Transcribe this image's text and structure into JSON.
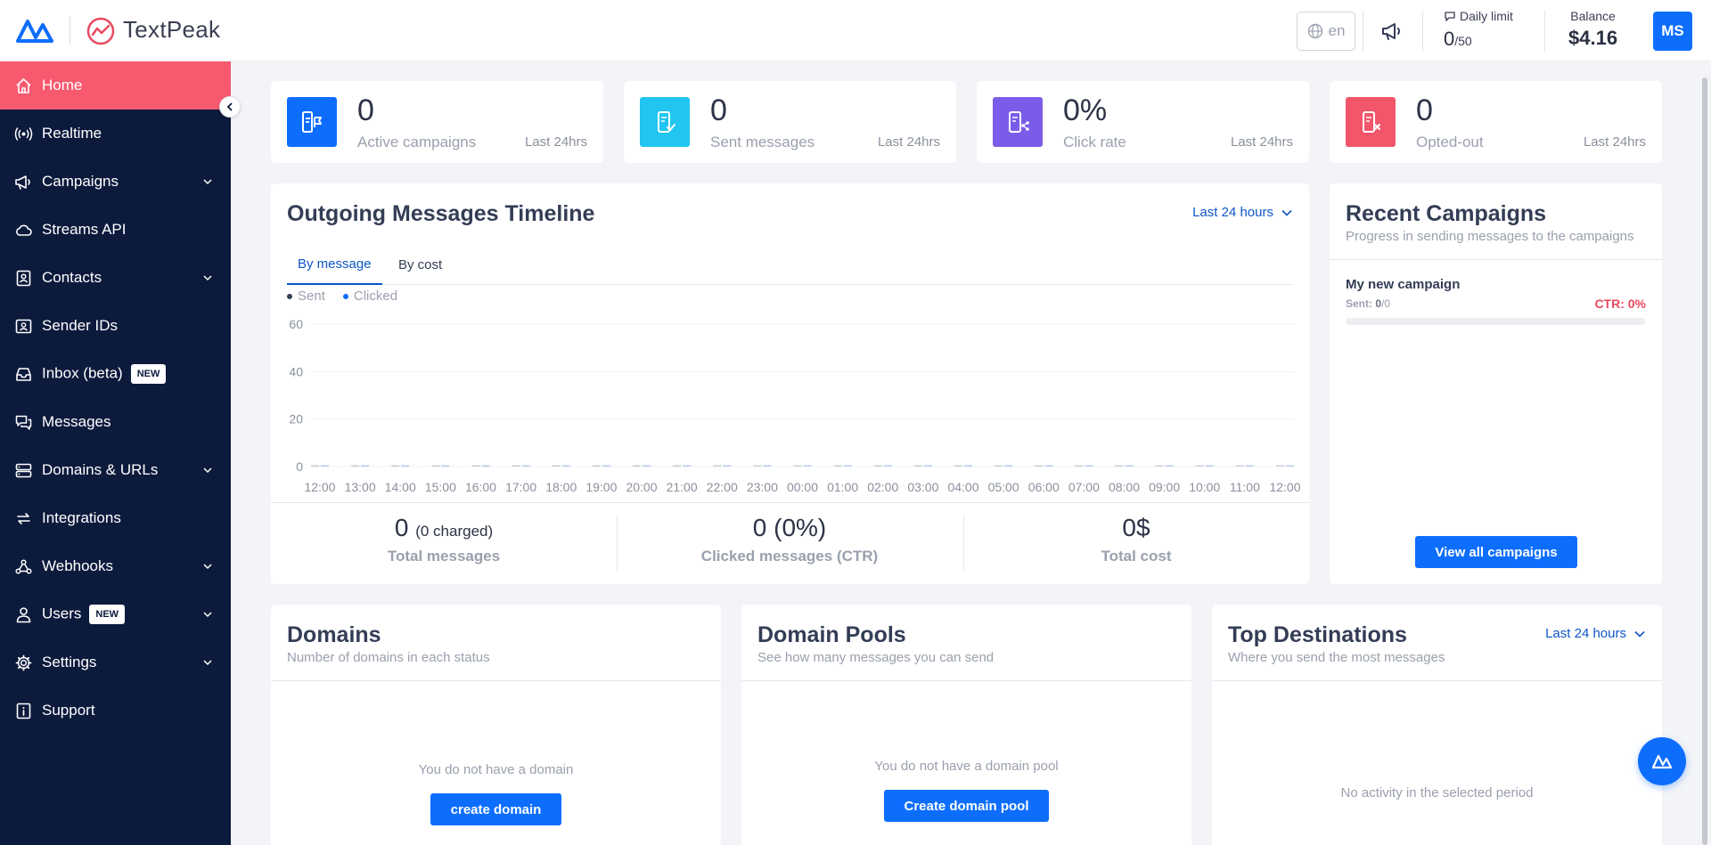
{
  "header": {
    "brand_name": "TextPeak",
    "language": "en",
    "daily_limit_label": "Daily limit",
    "daily_limit_used": "0",
    "daily_limit_max": "/50",
    "balance_label": "Balance",
    "balance_value": "$4.16",
    "avatar_initials": "MS"
  },
  "sidebar": {
    "items": [
      {
        "label": "Home",
        "icon": "home-icon",
        "active": true
      },
      {
        "label": "Realtime",
        "icon": "broadcast-icon"
      },
      {
        "label": "Campaigns",
        "icon": "megaphone-icon",
        "expandable": true
      },
      {
        "label": "Streams API",
        "icon": "cloud-icon"
      },
      {
        "label": "Contacts",
        "icon": "contact-book-icon",
        "expandable": true
      },
      {
        "label": "Sender IDs",
        "icon": "id-card-icon"
      },
      {
        "label": "Inbox (beta)",
        "icon": "inbox-icon",
        "badge": "NEW"
      },
      {
        "label": "Messages",
        "icon": "chat-icon"
      },
      {
        "label": "Domains & URLs",
        "icon": "server-icon",
        "expandable": true
      },
      {
        "label": "Integrations",
        "icon": "sync-icon"
      },
      {
        "label": "Webhooks",
        "icon": "webhook-icon",
        "expandable": true
      },
      {
        "label": "Users",
        "icon": "user-icon",
        "badge": "NEW",
        "expandable": true
      },
      {
        "label": "Settings",
        "icon": "gear-icon",
        "expandable": true
      },
      {
        "label": "Support",
        "icon": "info-icon"
      }
    ]
  },
  "stats": [
    {
      "value": "0",
      "label": "Active campaigns",
      "period": "Last 24hrs",
      "color": "#0d6efd"
    },
    {
      "value": "0",
      "label": "Sent messages",
      "period": "Last 24hrs",
      "color": "#22c5f0"
    },
    {
      "value": "0%",
      "label": "Click rate",
      "period": "Last 24hrs",
      "color": "#7b5ce8"
    },
    {
      "value": "0",
      "label": "Opted-out",
      "period": "Last 24hrs",
      "color": "#f2566b"
    }
  ],
  "timeline": {
    "title": "Outgoing Messages Timeline",
    "period": "Last 24 hours",
    "tabs": [
      "By message",
      "By cost"
    ],
    "legend": [
      {
        "label": "Sent",
        "color": "#333d55"
      },
      {
        "label": "Clicked",
        "color": "#0d6efd"
      }
    ],
    "totals": {
      "messages_value": "0",
      "messages_charged": "(0 charged)",
      "messages_label": "Total messages",
      "clicked_value": "0 (0%)",
      "clicked_label": "Clicked messages (CTR)",
      "cost_value": "0$",
      "cost_label": "Total cost"
    }
  },
  "chart_data": {
    "type": "bar",
    "categories": [
      "12:00",
      "13:00",
      "14:00",
      "15:00",
      "16:00",
      "17:00",
      "18:00",
      "19:00",
      "20:00",
      "21:00",
      "22:00",
      "23:00",
      "00:00",
      "01:00",
      "02:00",
      "03:00",
      "04:00",
      "05:00",
      "06:00",
      "07:00",
      "08:00",
      "09:00",
      "10:00",
      "11:00",
      "12:00"
    ],
    "series": [
      {
        "name": "Sent",
        "values": [
          0,
          0,
          0,
          0,
          0,
          0,
          0,
          0,
          0,
          0,
          0,
          0,
          0,
          0,
          0,
          0,
          0,
          0,
          0,
          0,
          0,
          0,
          0,
          0,
          0
        ]
      },
      {
        "name": "Clicked",
        "values": [
          0,
          0,
          0,
          0,
          0,
          0,
          0,
          0,
          0,
          0,
          0,
          0,
          0,
          0,
          0,
          0,
          0,
          0,
          0,
          0,
          0,
          0,
          0,
          0,
          0
        ]
      }
    ],
    "yticks": [
      0,
      20,
      40,
      60
    ],
    "ylim": [
      0,
      60
    ],
    "grid": true
  },
  "recent_campaigns": {
    "title": "Recent Campaigns",
    "subtitle": "Progress in sending messages to the campaigns",
    "items": [
      {
        "name": "My new campaign",
        "sent_label": "Sent:",
        "sent": "0",
        "total": "/0",
        "ctr": "CTR: 0%",
        "progress": 0
      }
    ],
    "view_all_label": "View all campaigns"
  },
  "domains": {
    "title": "Domains",
    "subtitle": "Number of domains in each status",
    "empty": "You do not have a domain",
    "button": "create domain"
  },
  "domain_pools": {
    "title": "Domain Pools",
    "subtitle": "See how many messages you can send",
    "empty": "You do not have a domain pool",
    "button": "Create domain pool"
  },
  "top_destinations": {
    "title": "Top Destinations",
    "subtitle": "Where you send the most messages",
    "period": "Last 24 hours",
    "empty": "No activity in the selected period"
  }
}
